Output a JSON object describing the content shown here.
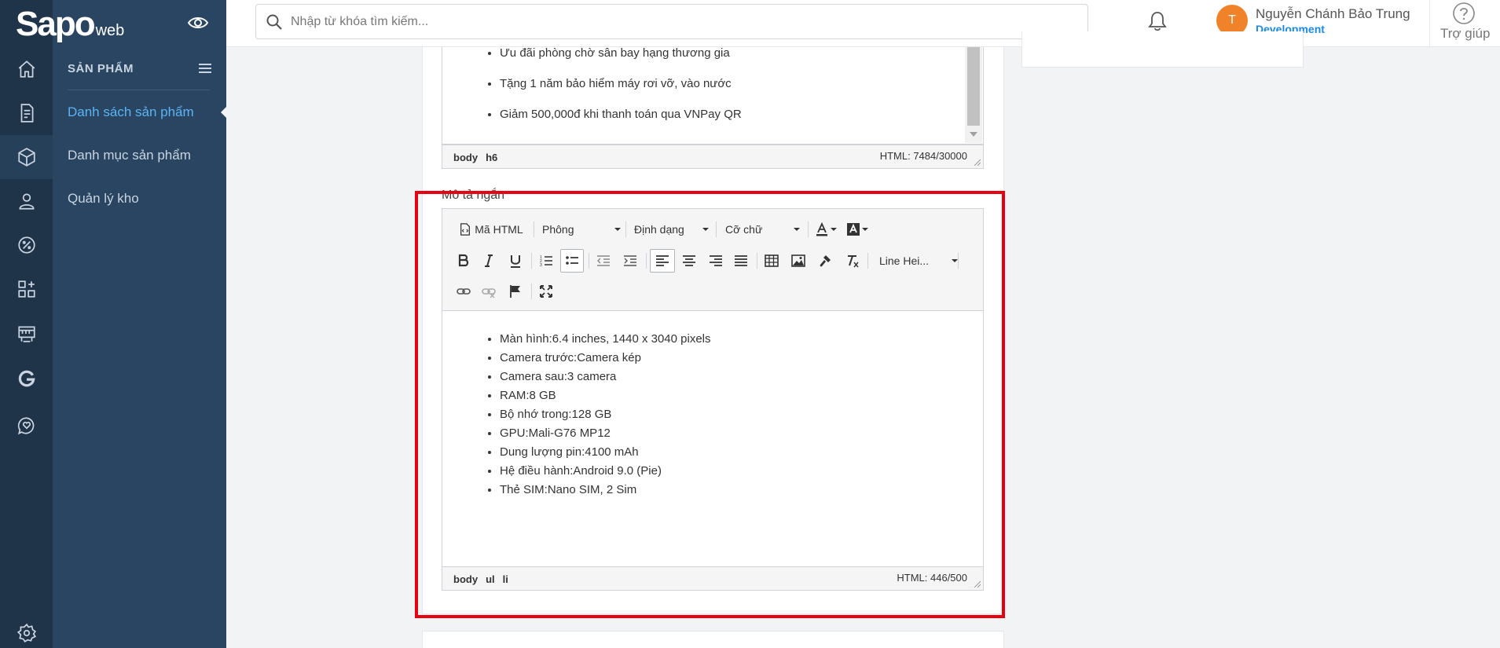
{
  "app": {
    "logo_text": "Sapo",
    "logo_suffix": "web"
  },
  "sidebar": {
    "header": "SẢN PHẨM",
    "items": [
      {
        "label": "Danh sách sản phẩm",
        "active": true
      },
      {
        "label": "Danh mục sản phẩm",
        "active": false
      },
      {
        "label": "Quản lý kho",
        "active": false
      }
    ]
  },
  "rail_icons": [
    "home-icon",
    "order-icon",
    "product-box-icon",
    "customer-icon",
    "discount-icon",
    "apps-icon",
    "store-icon",
    "google-icon",
    "chat-icon",
    "settings-icon"
  ],
  "topbar": {
    "search_placeholder": "Nhập từ khóa tìm kiếm...",
    "avatar_initial": "T",
    "user_name": "Nguyễn Chánh Bảo Trung",
    "user_role": "Development",
    "help_label": "Trợ giúp"
  },
  "description_editor": {
    "items": [
      "Ưu đãi phòng chờ sân bay hạng thương gia",
      "Tặng 1 năm bảo hiểm máy rơi vỡ, vào nước",
      "Giảm 500,000đ khi thanh toán qua VNPay QR"
    ],
    "path": [
      "body",
      "h6"
    ],
    "count": "HTML: 7484/30000"
  },
  "short_description": {
    "label": "Mô tả ngắn",
    "toolbar": {
      "html_button": "Mã HTML",
      "font_dropdown": "Phông",
      "format_dropdown": "Định dạng",
      "size_dropdown": "Cỡ chữ",
      "line_height_dropdown": "Line Hei..."
    },
    "items": [
      "Màn hình:6.4 inches, 1440 x 3040 pixels",
      "Camera trước:Camera kép",
      "Camera sau:3 camera",
      "RAM:8 GB",
      "Bộ nhớ trong:128 GB",
      "GPU:Mali-G76 MP12",
      "Dung lượng pin:4100 mAh",
      "Hệ điều hành:Android 9.0 (Pie)",
      "Thẻ SIM:Nano SIM, 2 Sim"
    ],
    "path": [
      "body",
      "ul",
      "li"
    ],
    "count": "HTML: 446/500"
  },
  "colors": {
    "rail": "#1f3349",
    "panel": "#2a4561",
    "active_link": "#5ab4f5",
    "avatar": "#f0832a",
    "role": "#1a8ae5",
    "highlight": "#e60012"
  }
}
